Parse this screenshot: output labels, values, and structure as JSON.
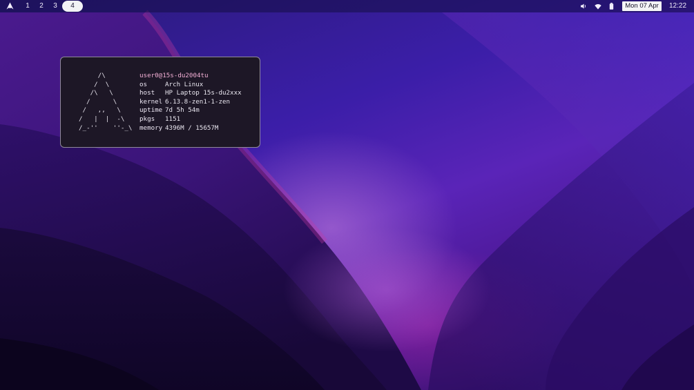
{
  "topbar": {
    "launcher_icon": "arch-logo-icon",
    "workspaces": [
      {
        "label": "1",
        "active": false
      },
      {
        "label": "2",
        "active": false
      },
      {
        "label": "3",
        "active": false
      },
      {
        "label": "4",
        "active": true
      }
    ],
    "tray": {
      "volume_icon": "speaker-icon",
      "wifi_icon": "wifi-icon",
      "battery_icon": "battery-icon"
    },
    "date": "Mon 07 Apr",
    "time": "12:22"
  },
  "terminal": {
    "ascii_art": "     /\\\n    /  \\\n   /\\   \\\n  /      \\\n /   ,,   \\\n/   |  |  -\\\n/_-''    ''-_\\",
    "user_host": "user0@15s-du2004tu",
    "fetch": [
      {
        "key": "os",
        "value": "Arch Linux"
      },
      {
        "key": "host",
        "value": "HP Laptop 15s-du2xxx"
      },
      {
        "key": "kernel",
        "value": "6.13.8-zen1-1-zen"
      },
      {
        "key": "uptime",
        "value": "7d 5h 54m"
      },
      {
        "key": "pkgs",
        "value": "1151"
      },
      {
        "key": "memory",
        "value": "4396M / 15657M"
      }
    ]
  },
  "colors": {
    "accent_user": "#f4b0d6",
    "terminal_bg": "#1d1726",
    "terminal_border": "#8f8a99",
    "active_workspace_bg": "#f2f2f5"
  }
}
